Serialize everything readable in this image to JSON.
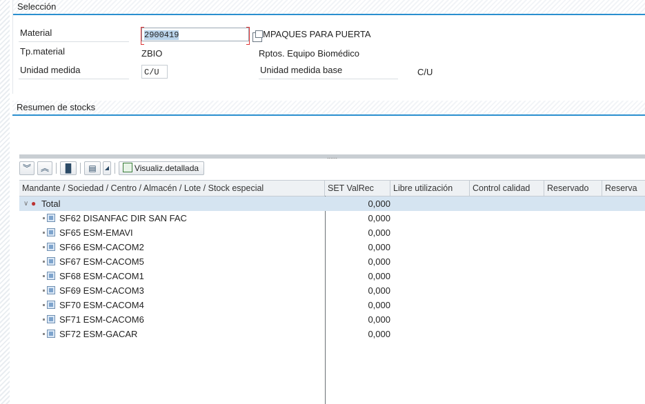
{
  "selection": {
    "title": "Selección",
    "material_label": "Material",
    "material_value": "2900419",
    "material_desc": "MPAQUES PARA PUERTA",
    "tp_label": "Tp.material",
    "tp_value": "ZBIO",
    "tp_desc": "Rptos. Equipo Biomédico",
    "unidad_label": "Unidad medida",
    "unidad_value": "C/U",
    "base_label": "Unidad medida base",
    "base_value": "C/U"
  },
  "summary": {
    "title": "Resumen de stocks",
    "splitter_handle": "......"
  },
  "toolbar": {
    "detail_label": "Visualiz.detallada"
  },
  "table": {
    "headers": [
      "Mandante / Sociedad / Centro / Almacén / Lote / Stock especial",
      "SET ValRec",
      "Libre utilización",
      "Control calidad",
      "Reservado",
      "Reserva"
    ],
    "total": {
      "name": "Total",
      "value": "0,000"
    },
    "rows": [
      {
        "name": "SF62 DISANFAC DIR SAN FAC",
        "value": "0,000"
      },
      {
        "name": "SF65 ESM-EMAVI",
        "value": "0,000"
      },
      {
        "name": "SF66 ESM-CACOM2",
        "value": "0,000"
      },
      {
        "name": "SF67 ESM-CACOM5",
        "value": "0,000"
      },
      {
        "name": "SF68 ESM-CACOM1",
        "value": "0,000"
      },
      {
        "name": "SF69 ESM-CACOM3",
        "value": "0,000"
      },
      {
        "name": "SF70 ESM-CACOM4",
        "value": "0,000"
      },
      {
        "name": "SF71 ESM-CACOM6",
        "value": "0,000"
      },
      {
        "name": "SF72 ESM-GACAR",
        "value": "0,000"
      }
    ]
  }
}
